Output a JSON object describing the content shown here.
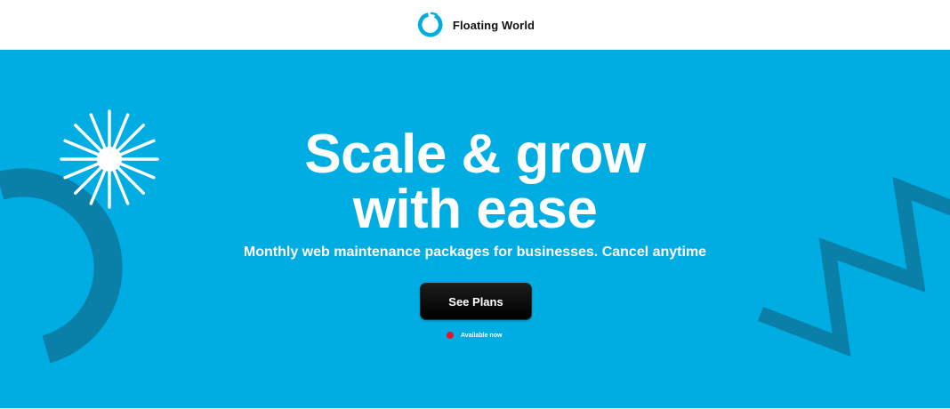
{
  "header": {
    "brand_name": "Floating World",
    "logo_icon": "circle-ring-logo-icon"
  },
  "hero": {
    "headline_line1": "Scale & grow",
    "headline_line2": "with ease",
    "subtitle": "Monthly web maintenance packages for businesses. Cancel anytime",
    "cta_label": "See Plans",
    "status_text": "Available now",
    "decorations": [
      "starburst-icon",
      "ring-arc-shape",
      "zigzag-shape"
    ]
  },
  "colors": {
    "hero_background": "#00ade2",
    "decor_dark": "#0a7fa8",
    "cta_background": "#000000",
    "status_dot": "#e8132a",
    "brand_accent": "#00ade2"
  }
}
